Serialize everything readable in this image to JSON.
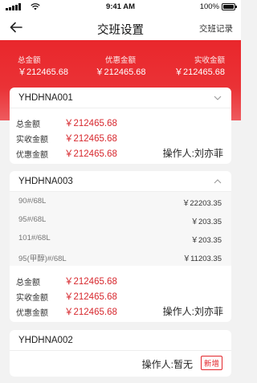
{
  "status_bar": {
    "time": "9:41 AM",
    "battery": "100%"
  },
  "nav": {
    "title": "交班设置",
    "right_link": "交班记录"
  },
  "summary": {
    "total_label": "总金额",
    "total_value": "￥212465.68",
    "discount_label": "优惠金额",
    "discount_value": "￥212465.68",
    "received_label": "实收金额",
    "received_value": "￥212465.68"
  },
  "cards": [
    {
      "code": "YHDHNA001",
      "totals": [
        {
          "label": "总金额",
          "amount": "￥212465.68"
        },
        {
          "label": "实收金额",
          "amount": "￥212465.68"
        },
        {
          "label": "优惠金额",
          "amount": "￥212465.68"
        }
      ],
      "operator": "操作人:刘亦菲"
    },
    {
      "code": "YHDHNA003",
      "items": [
        {
          "name": "90#/68L",
          "price": "￥22203.35"
        },
        {
          "name": "95#/68L",
          "price": "￥203.35"
        },
        {
          "name": "101#/68L",
          "price": "￥203.35"
        },
        {
          "name": "95(甲醇)#/68L",
          "price": "￥11203.35"
        }
      ],
      "totals": [
        {
          "label": "总金额",
          "amount": "￥212465.68"
        },
        {
          "label": "实收金额",
          "amount": "￥212465.68"
        },
        {
          "label": "优惠金额",
          "amount": "￥212465.68"
        }
      ],
      "operator": "操作人:刘亦菲"
    },
    {
      "code": "YHDHNA002",
      "operator": "操作人:暂无",
      "badge": "新增"
    }
  ],
  "colors": {
    "accent": "#e9272c",
    "amount": "#d7282e",
    "background": "#f2f2f2"
  }
}
